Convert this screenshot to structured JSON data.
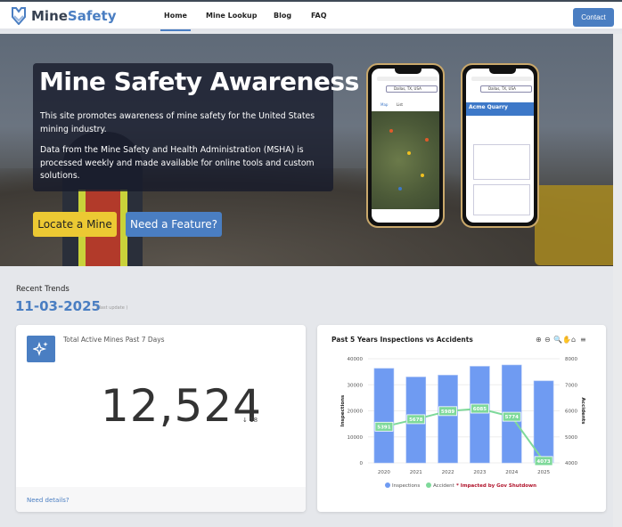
{
  "nav": {
    "brand_a": "Mine",
    "brand_b": "Safety",
    "links": [
      {
        "label": "Home",
        "active": true
      },
      {
        "label": "Mine Lookup"
      },
      {
        "label": "Blog"
      },
      {
        "label": "FAQ"
      }
    ],
    "contact": "Contact"
  },
  "hero": {
    "title": "Mine Safety Awareness",
    "p1": "This site promotes awareness of mine safety for the United States mining industry.",
    "p2": "Data from the Mine Safety and Health Administration (MSHA) is processed weekly and made available for online tools and custom solutions.",
    "btn_locate": "Locate a Mine",
    "btn_feature": "Need a Feature?",
    "phone1": {
      "search": "Dallas, TX, USA",
      "tab_map": "Map",
      "tab_list": "List"
    },
    "phone2": {
      "search": "Dallas, TX, USA",
      "mine_name": "Acme Quarry"
    }
  },
  "trends": {
    "label": "Recent Trends",
    "date": "11-03-2025",
    "last_update": "( last update )"
  },
  "card1": {
    "title": "Total Active Mines Past 7 Days",
    "value": "12,524",
    "delta": "18",
    "delta_direction": "down",
    "link": "Need details?",
    "icon": "sparkles-icon"
  },
  "colors": {
    "accent": "#4a7ec2",
    "yellow": "#ecc933",
    "bar": "#6f9bf2",
    "line": "#7ed99a",
    "note": "#b0122a"
  },
  "chart_data": {
    "type": "bar+line",
    "title": "Past 5 Years Inspections vs Accidents",
    "categories": [
      "2020",
      "2021",
      "2022",
      "2023",
      "2024",
      "2025"
    ],
    "series": [
      {
        "name": "Inspections",
        "type": "bar",
        "axis": "left",
        "values": [
          36300,
          33000,
          33700,
          37100,
          37600,
          31500
        ]
      },
      {
        "name": "Accident",
        "type": "line",
        "axis": "right",
        "values": [
          5391,
          5678,
          5989,
          6085,
          5774,
          4073
        ]
      }
    ],
    "ylabel_left": "Inspections",
    "ylabel_right": "Accidents",
    "ylim_left": [
      0,
      40000
    ],
    "yticks_left": [
      "0",
      "10000",
      "20000",
      "30000",
      "40000"
    ],
    "ylim_right": [
      4000,
      8000
    ],
    "yticks_right": [
      "4000",
      "5000",
      "6000",
      "7000",
      "8000"
    ],
    "legend_note": "* Impacted by Gov Shutdown",
    "legend_placement": "bottom",
    "grid": true,
    "toolbar": [
      "zoom-in-icon",
      "zoom-out-icon",
      "magnifier-icon",
      "pan-hand-icon",
      "home-icon",
      "menu-icon"
    ]
  }
}
